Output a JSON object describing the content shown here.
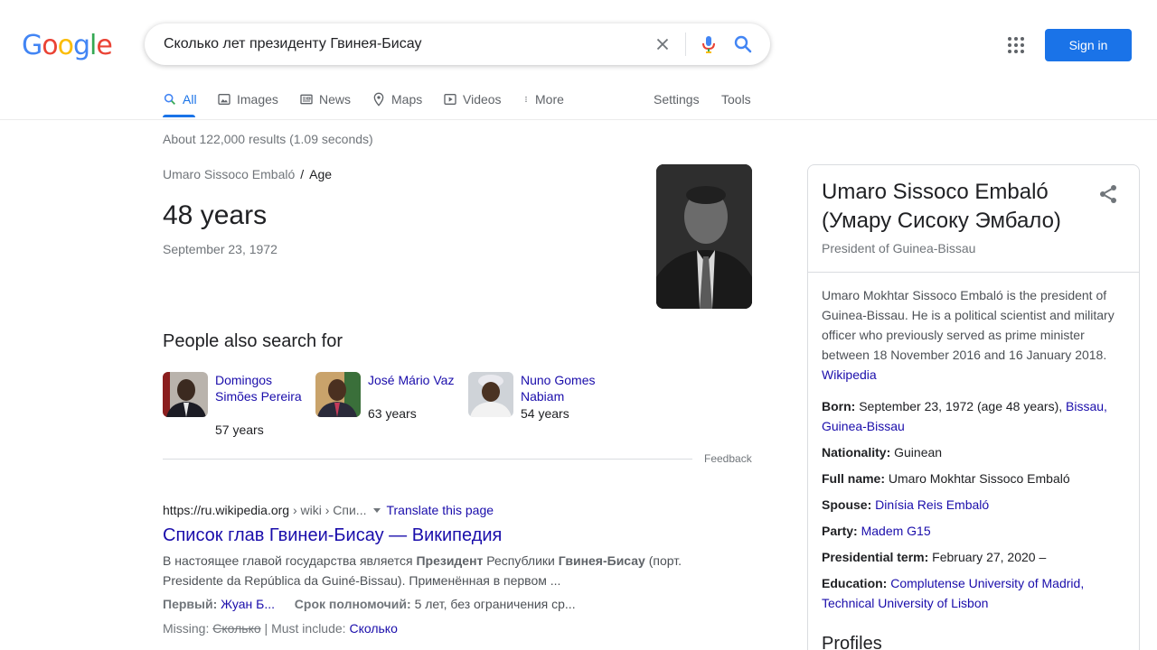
{
  "logo": {
    "letters": [
      "G",
      "o",
      "o",
      "g",
      "l",
      "e"
    ],
    "colors": [
      "#4285f4",
      "#ea4335",
      "#fbbc05",
      "#4285f4",
      "#34a853",
      "#ea4335"
    ]
  },
  "search": {
    "query": "Сколько лет президенту Гвинея-Бисау"
  },
  "header": {
    "signin_label": "Sign in"
  },
  "tabs": [
    {
      "label": "All",
      "icon": "search-icon"
    },
    {
      "label": "Images",
      "icon": "image-icon"
    },
    {
      "label": "News",
      "icon": "news-icon"
    },
    {
      "label": "Maps",
      "icon": "map-pin-icon"
    },
    {
      "label": "Videos",
      "icon": "video-icon"
    },
    {
      "label": "More",
      "icon": "more-vert-icon"
    },
    {
      "label": "Settings"
    },
    {
      "label": "Tools"
    }
  ],
  "result_stats": "About 122,000 results (1.09 seconds)",
  "answer": {
    "breadcrumb_entity": "Umaro Sissoco Embaló",
    "breadcrumb_sep": "/",
    "breadcrumb_attr": "Age",
    "value": "48 years",
    "detail": "September 23, 1972"
  },
  "people_also_search": {
    "title": "People also search for",
    "items": [
      {
        "name": "Domingos Simões Pereira",
        "age": "57 years"
      },
      {
        "name": "José Mário Vaz",
        "age": "63 years"
      },
      {
        "name": "Nuno Gomes Nabiam",
        "age": "54 years"
      }
    ],
    "feedback": "Feedback"
  },
  "result": {
    "domain": "https://ru.wikipedia.org",
    "path": " › wiki › Спи...",
    "translate": "Translate this page",
    "title": "Список глав Гвинеи-Бисау — Википедия",
    "snippet_1": "В настоящее главой государства является ",
    "snippet_b1": "Президент",
    "snippet_2": " Республики ",
    "snippet_b2": "Гвинея-Бисау",
    "snippet_3": " (порт. Presidente da República da Guiné-Bissau). Применённая в первом ...",
    "fact1_label": "Первый:",
    "fact1_value": "Жуан Б...",
    "fact2_label": "Срок полномочий:",
    "fact2_value": "5 лет, без ограничения ср...",
    "missing_label": "Missing:",
    "missing_word": "Сколько",
    "must_include_label": " | Must include: ",
    "must_include_word": "Сколько"
  },
  "knowledge_panel": {
    "title": "Umaro Sissoco Embaló (Умару Сисоку Эмбало)",
    "subtitle": "President of Guinea-Bissau",
    "description": "Umaro Mokhtar Sissoco Embaló is the president of Guinea-Bissau. He is a political scientist and military officer who previously served as prime minister between 18 November 2016 and 16 January 2018.",
    "description_source": "Wikipedia",
    "facts": [
      {
        "label": "Born:",
        "text": "September 23, 1972 (age 48 years), ",
        "link": "Bissau, Guinea-Bissau"
      },
      {
        "label": "Nationality:",
        "text": "Guinean",
        "link": ""
      },
      {
        "label": "Full name:",
        "text": "Umaro Mokhtar Sissoco Embaló",
        "link": ""
      },
      {
        "label": "Spouse:",
        "text": "",
        "link": "Dinísia Reis Embaló"
      },
      {
        "label": "Party:",
        "text": "",
        "link": "Madem G15"
      },
      {
        "label": "Presidential term:",
        "text": "February 27, 2020 –",
        "link": ""
      },
      {
        "label": "Education:",
        "text": "",
        "link": "Complutense University of Madrid, Technical University of Lisbon"
      }
    ],
    "profiles_heading": "Profiles"
  },
  "colors": {
    "accent": "#1a73e8",
    "link": "#1a0dab",
    "muted": "#70757a"
  }
}
